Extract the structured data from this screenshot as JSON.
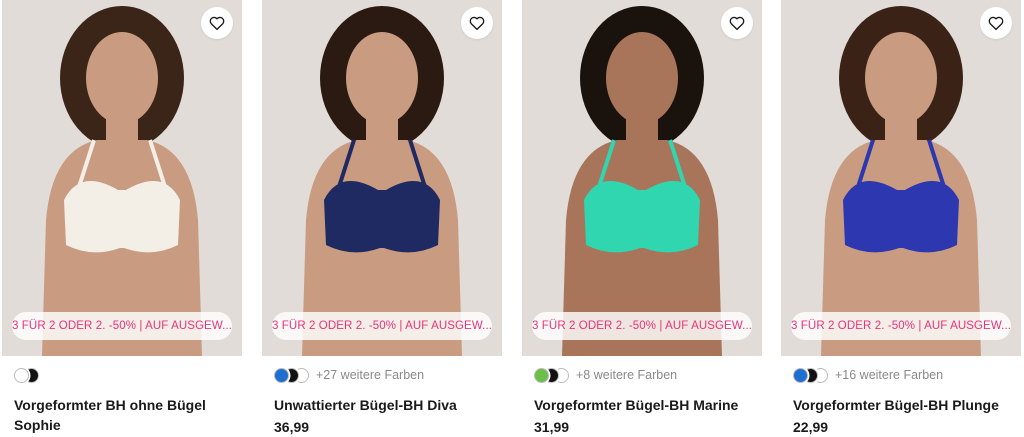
{
  "products": [
    {
      "name": "Vorgeformter BH ohne Bügel Sophie",
      "price": "",
      "promo": "3 FÜR 2 ODER 2. -50% | AUF AUSGEW...",
      "more_colors": "",
      "swatches": [
        "#ffffff",
        "#111111"
      ],
      "product_color": "#f3efe6",
      "hair_color": "#3b2418"
    },
    {
      "name": "Unwattierter Bügel-BH Diva",
      "price": "36,99",
      "promo": "3 FÜR 2 ODER 2. -50% | AUF AUSGEW...",
      "more_colors": "+27 weitere Farben",
      "swatches": [
        "#1f6fd1",
        "#111111",
        "#ffffff"
      ],
      "product_color": "#1f2a63",
      "hair_color": "#2a1a12"
    },
    {
      "name": "Vorgeformter Bügel-BH Marine",
      "price": "31,99",
      "promo": "3 FÜR 2 ODER 2. -50% | AUF AUSGEW...",
      "more_colors": "+8 weitere Farben",
      "swatches": [
        "#6cc04a",
        "#111111",
        "#ffffff"
      ],
      "product_color": "#2fd6b0",
      "hair_color": "#1a120c"
    },
    {
      "name": "Vorgeformter Bügel-BH Plunge",
      "price": "22,99",
      "promo": "3 FÜR 2 ODER 2. -50% | AUF AUSGEW...",
      "more_colors": "+16 weitere Farben",
      "swatches": [
        "#1f6fd1",
        "#111111",
        "#ffffff"
      ],
      "product_color": "#2c37b0",
      "hair_color": "#3a2316"
    }
  ],
  "colors": {
    "promo_text": "#e8347a",
    "skin_light": "#c99b80",
    "skin_medium": "#a9755a"
  },
  "icons": {
    "wishlist": "heart-outline-icon"
  }
}
